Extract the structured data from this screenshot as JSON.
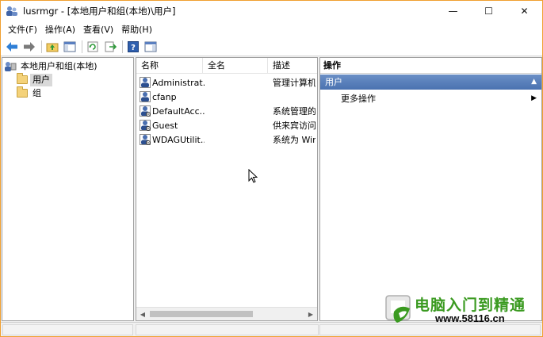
{
  "window": {
    "title": "lusrmgr - [本地用户和组(本地)\\用户]",
    "controls": {
      "minimize": "—",
      "maximize": "☐",
      "close": "✕"
    }
  },
  "menu": {
    "items": [
      "文件(F)",
      "操作(A)",
      "查看(V)",
      "帮助(H)"
    ]
  },
  "tree": {
    "root": "本地用户和组(本地)",
    "children": [
      "用户",
      "组"
    ],
    "selected": "用户"
  },
  "list": {
    "columns": [
      "名称",
      "全名",
      "描述"
    ],
    "rows": [
      {
        "name": "Administrat...",
        "fullname": "",
        "description": "管理计算机("
      },
      {
        "name": "cfanp",
        "fullname": "",
        "description": ""
      },
      {
        "name": "DefaultAcc...",
        "fullname": "",
        "description": "系统管理的月"
      },
      {
        "name": "Guest",
        "fullname": "",
        "description": "供来宾访问讠"
      },
      {
        "name": "WDAGUtilit...",
        "fullname": "",
        "description": "系统为 Winc"
      }
    ]
  },
  "actions": {
    "title": "操作",
    "group": "用户",
    "items": [
      "更多操作"
    ]
  },
  "watermark": {
    "line1": "电脑入门到精通",
    "line2": "www.58116.cn"
  },
  "colors": {
    "window_border": "#f0a030",
    "actions_group_bg": "#4a72b0",
    "watermark_green": "#3a9a20"
  }
}
